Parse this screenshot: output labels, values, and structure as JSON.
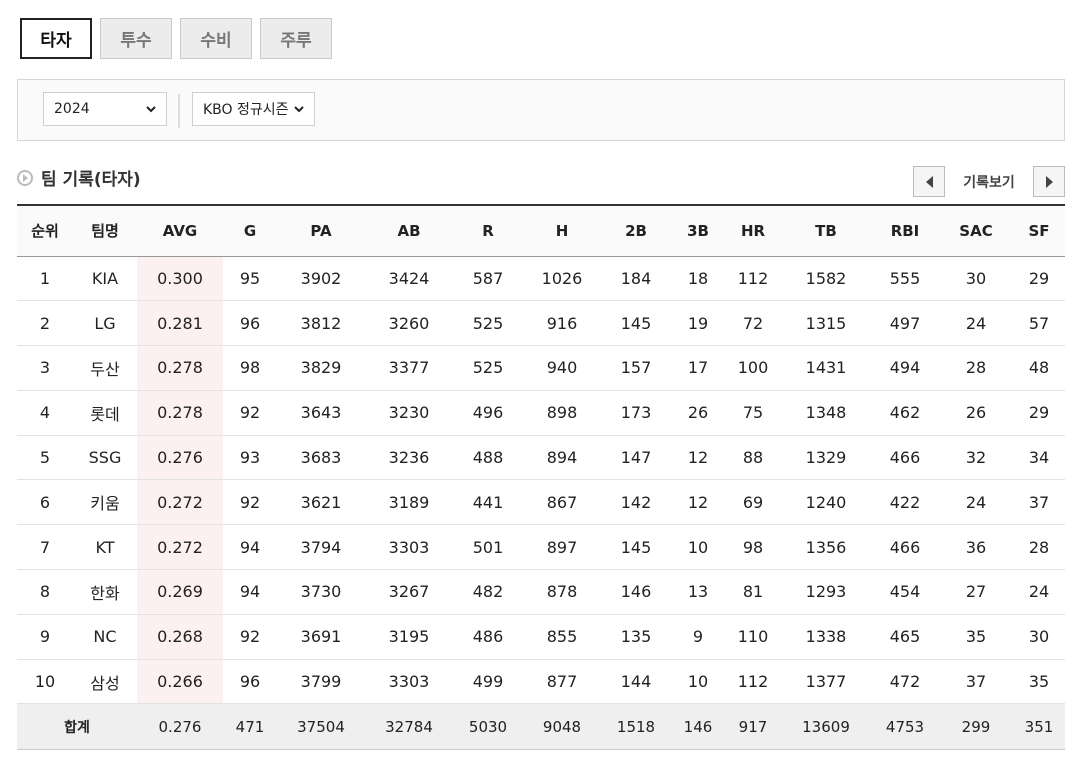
{
  "tabs": [
    {
      "label": "타자",
      "active": true
    },
    {
      "label": "투수",
      "active": false
    },
    {
      "label": "수비",
      "active": false
    },
    {
      "label": "주루",
      "active": false
    }
  ],
  "filters": {
    "year": "2024",
    "season": "KBO 정규시즌"
  },
  "section": {
    "title": "팀 기록(타자)",
    "nav_label": "기록보기"
  },
  "table": {
    "columns": [
      "순위",
      "팀명",
      "AVG",
      "G",
      "PA",
      "AB",
      "R",
      "H",
      "2B",
      "3B",
      "HR",
      "TB",
      "RBI",
      "SAC",
      "SF"
    ],
    "rows": [
      [
        "1",
        "KIA",
        "0.300",
        "95",
        "3902",
        "3424",
        "587",
        "1026",
        "184",
        "18",
        "112",
        "1582",
        "555",
        "30",
        "29"
      ],
      [
        "2",
        "LG",
        "0.281",
        "96",
        "3812",
        "3260",
        "525",
        "916",
        "145",
        "19",
        "72",
        "1315",
        "497",
        "24",
        "57"
      ],
      [
        "3",
        "두산",
        "0.278",
        "98",
        "3829",
        "3377",
        "525",
        "940",
        "157",
        "17",
        "100",
        "1431",
        "494",
        "28",
        "48"
      ],
      [
        "4",
        "롯데",
        "0.278",
        "92",
        "3643",
        "3230",
        "496",
        "898",
        "173",
        "26",
        "75",
        "1348",
        "462",
        "26",
        "29"
      ],
      [
        "5",
        "SSG",
        "0.276",
        "93",
        "3683",
        "3236",
        "488",
        "894",
        "147",
        "12",
        "88",
        "1329",
        "466",
        "32",
        "34"
      ],
      [
        "6",
        "키움",
        "0.272",
        "92",
        "3621",
        "3189",
        "441",
        "867",
        "142",
        "12",
        "69",
        "1240",
        "422",
        "24",
        "37"
      ],
      [
        "7",
        "KT",
        "0.272",
        "94",
        "3794",
        "3303",
        "501",
        "897",
        "145",
        "10",
        "98",
        "1356",
        "466",
        "36",
        "28"
      ],
      [
        "8",
        "한화",
        "0.269",
        "94",
        "3730",
        "3267",
        "482",
        "878",
        "146",
        "13",
        "81",
        "1293",
        "454",
        "27",
        "24"
      ],
      [
        "9",
        "NC",
        "0.268",
        "92",
        "3691",
        "3195",
        "486",
        "855",
        "135",
        "9",
        "110",
        "1338",
        "465",
        "35",
        "30"
      ],
      [
        "10",
        "삼성",
        "0.266",
        "96",
        "3799",
        "3303",
        "499",
        "877",
        "144",
        "10",
        "112",
        "1377",
        "472",
        "37",
        "35"
      ]
    ],
    "total": {
      "label": "합계",
      "values": [
        "0.276",
        "471",
        "37504",
        "32784",
        "5030",
        "9048",
        "1518",
        "146",
        "917",
        "13609",
        "4753",
        "299",
        "351"
      ]
    }
  }
}
